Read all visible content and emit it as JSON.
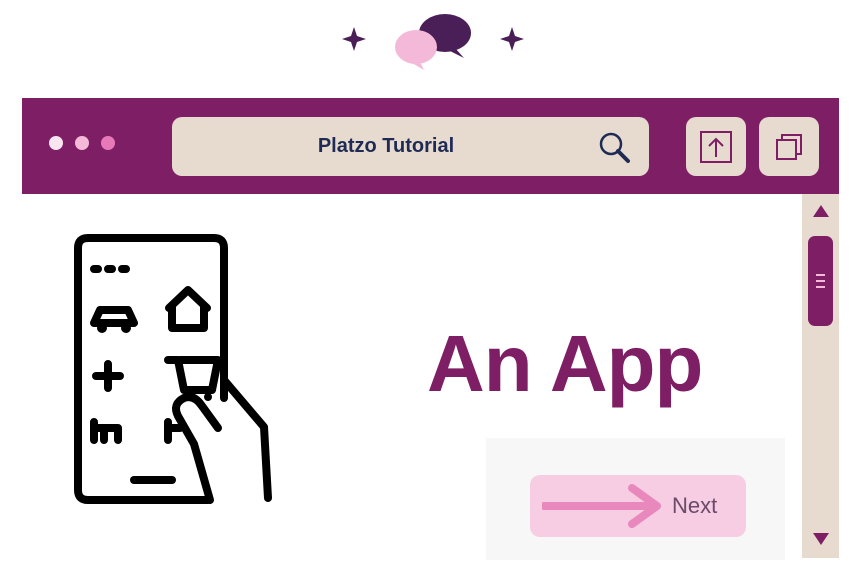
{
  "logo": {
    "icon": "chat-bubbles-icon",
    "colors": {
      "dark": "#4a1f57",
      "light": "#f4b9d8",
      "sparkle": "#4a1f57"
    }
  },
  "window": {
    "colors": {
      "titlebar": "#7e1f66",
      "field": "#e6dbce",
      "text": "#1f2a55"
    },
    "controls": [
      "dot-light",
      "dot-pink",
      "dot-magenta"
    ],
    "address": {
      "title": "Platzo Tutorial",
      "icon": "search-icon"
    },
    "toolbar": {
      "share_icon": "upload-icon",
      "copy_icon": "copy-icon"
    }
  },
  "scrollbar": {
    "up_icon": "triangle-up-icon",
    "down_icon": "triangle-down-icon",
    "position": 0.15
  },
  "content": {
    "illustration": "smartphone-app-icons-icon",
    "heading": "An App",
    "heading_color": "#7e1f66",
    "next_button": {
      "label": "Next",
      "icon": "arrow-right-icon",
      "colors": {
        "background": "#f6cde2",
        "arrow": "#e888bd"
      }
    }
  }
}
